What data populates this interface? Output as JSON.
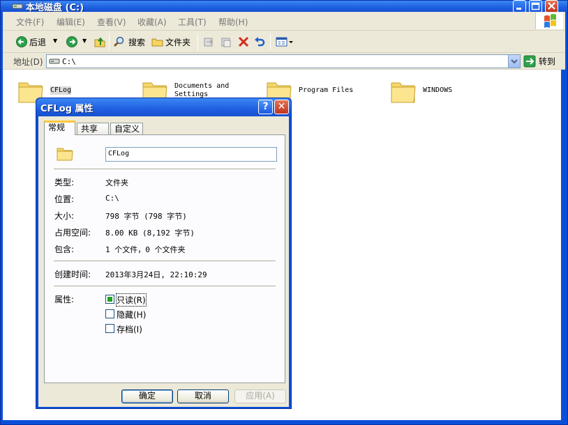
{
  "window": {
    "title": "本地磁盘 (C:)"
  },
  "menu": [
    "文件(F)",
    "编辑(E)",
    "查看(V)",
    "收藏(A)",
    "工具(T)",
    "帮助(H)"
  ],
  "toolbar": {
    "back": "后退",
    "search": "搜索",
    "folders": "文件夹"
  },
  "address": {
    "label": "地址(D)",
    "value": "C:\\",
    "go": "转到"
  },
  "folders": [
    {
      "name": "CFLog"
    },
    {
      "name": "Documents and Settings"
    },
    {
      "name": "Program Files"
    },
    {
      "name": "WINDOWS"
    }
  ],
  "dialog": {
    "title": "CFLog 属性",
    "help": "?",
    "close": "✕",
    "tabs": [
      "常规",
      "共享",
      "自定义"
    ],
    "name": "CFLog",
    "rows": [
      {
        "key": "类型:",
        "value": "文件夹"
      },
      {
        "key": "位置:",
        "value": "C:\\"
      },
      {
        "key": "大小:",
        "value": "798 字节 (798 字节)"
      },
      {
        "key": "占用空间:",
        "value": "8.00 KB (8,192 字节)"
      },
      {
        "key": "包含:",
        "value": "1 个文件，0 个文件夹"
      }
    ],
    "created_label": "创建时间:",
    "created_value": "2013年3月24日, 22:10:29",
    "attr_label": "属性:",
    "attributes": [
      {
        "label": "只读(R)",
        "checked": true
      },
      {
        "label": "隐藏(H)",
        "checked": false
      },
      {
        "label": "存档(I)",
        "checked": false
      }
    ],
    "buttons": {
      "ok": "确定",
      "cancel": "取消",
      "apply": "应用(A)"
    }
  }
}
